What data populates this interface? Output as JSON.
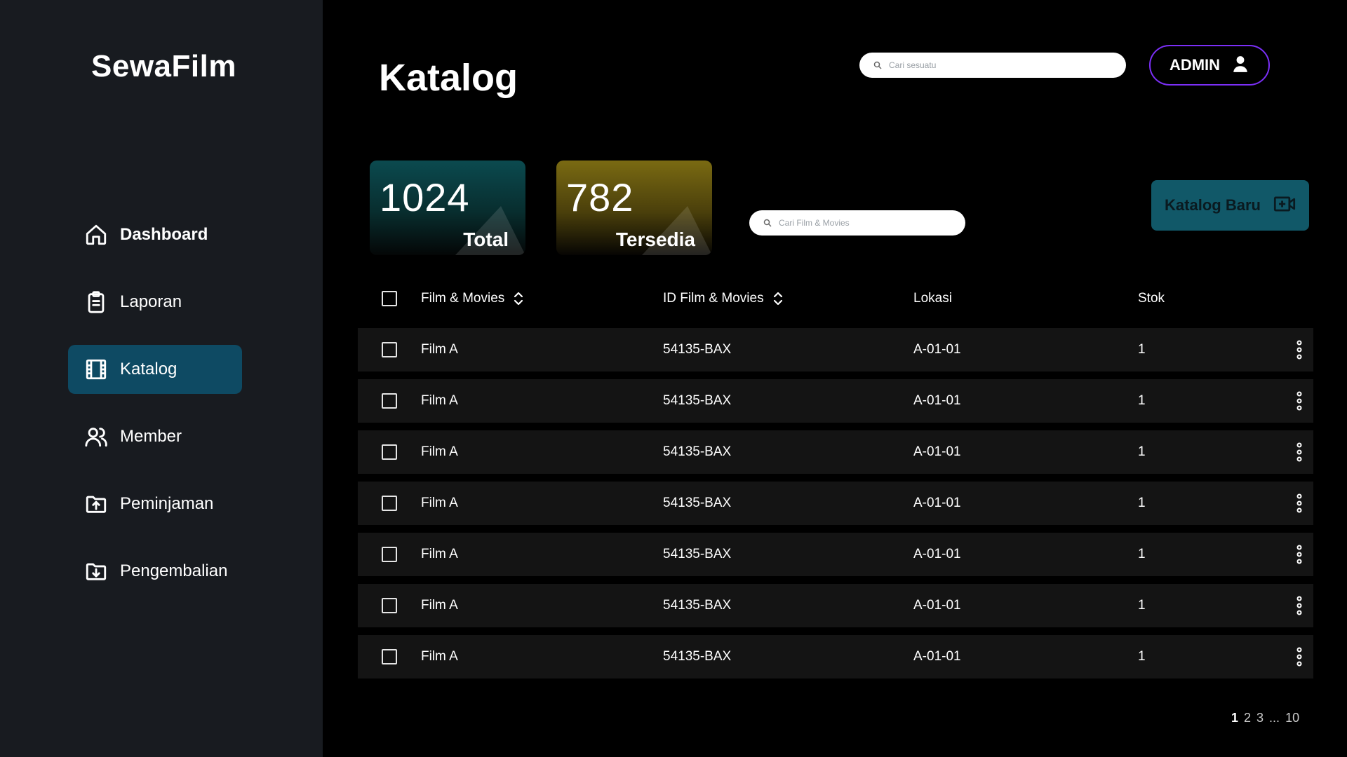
{
  "brand": "SewaFilm",
  "nav": [
    {
      "label": "Dashboard",
      "icon": "home-icon"
    },
    {
      "label": "Laporan",
      "icon": "clipboard-icon"
    },
    {
      "label": "Katalog",
      "icon": "film-icon",
      "active": true
    },
    {
      "label": "Member",
      "icon": "users-icon"
    },
    {
      "label": "Peminjaman",
      "icon": "folder-upload-icon"
    },
    {
      "label": "Pengembalian",
      "icon": "folder-download-icon"
    }
  ],
  "page_title": "Katalog",
  "top_search": {
    "placeholder": "Cari sesuatu",
    "icon": "search-icon"
  },
  "admin": {
    "label": "ADMIN",
    "icon": "user-icon"
  },
  "stats": {
    "total": {
      "value": "1024",
      "label": "Total"
    },
    "available": {
      "value": "782",
      "label": "Tersedia"
    }
  },
  "film_search": {
    "placeholder": "Cari Film & Movies",
    "icon": "search-icon"
  },
  "new_button": {
    "label": "Katalog Baru",
    "icon": "video-plus-icon"
  },
  "table": {
    "headers": {
      "film": "Film & Movies",
      "id": "ID Film & Movies",
      "location": "Lokasi",
      "stock": "Stok"
    },
    "rows": [
      {
        "film": "Film A",
        "id": "54135-BAX",
        "location": "A-01-01",
        "stock": "1"
      },
      {
        "film": "Film A",
        "id": "54135-BAX",
        "location": "A-01-01",
        "stock": "1"
      },
      {
        "film": "Film A",
        "id": "54135-BAX",
        "location": "A-01-01",
        "stock": "1"
      },
      {
        "film": "Film A",
        "id": "54135-BAX",
        "location": "A-01-01",
        "stock": "1"
      },
      {
        "film": "Film A",
        "id": "54135-BAX",
        "location": "A-01-01",
        "stock": "1"
      },
      {
        "film": "Film A",
        "id": "54135-BAX",
        "location": "A-01-01",
        "stock": "1"
      },
      {
        "film": "Film A",
        "id": "54135-BAX",
        "location": "A-01-01",
        "stock": "1"
      }
    ]
  },
  "pagination": {
    "p1": "1",
    "p2": "2",
    "p3": "3",
    "ellipsis": "...",
    "last": "10"
  },
  "colors": {
    "accent": "#0e4a63",
    "admin_border": "#7b2ff7",
    "new_button": "#115868"
  }
}
